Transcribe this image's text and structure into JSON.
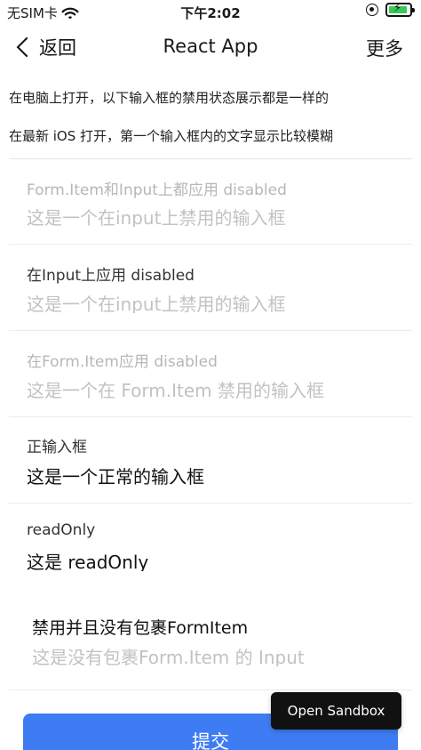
{
  "status_bar": {
    "carrier": "无SIM卡",
    "time": "下午2:02"
  },
  "nav": {
    "back_label": "返回",
    "title": "React App",
    "more_label": "更多"
  },
  "notes": [
    "在电脑上打开，以下输入框的禁用状态展示都是一样的",
    "在最新 iOS 打开，第一个输入框内的文字显示比较模糊"
  ],
  "form_items": [
    {
      "label": "Form.Item和Input上都应用 disabled",
      "value": "这是一个在input上禁用的输入框",
      "disabled": true
    },
    {
      "label": "在Input上应用 disabled",
      "value": "这是一个在input上禁用的输入框",
      "disabled": true
    },
    {
      "label": "在Form.Item应用 disabled",
      "value": "这是一个在 Form.Item 禁用的输入框",
      "disabled": true
    },
    {
      "label": "正输入框",
      "value": "这是一个正常的输入框",
      "disabled": false
    },
    {
      "label": "readOnly",
      "value": "这是 readOnly",
      "disabled": false
    }
  ],
  "standalone": {
    "label": "禁用并且没有包裹FormItem",
    "value": "这是没有包裹Form.Item 的 Input"
  },
  "submit_label": "提交",
  "sandbox_label": "Open Sandbox",
  "colors": {
    "primary": "#3d7cf2",
    "battery": "#38c759"
  }
}
